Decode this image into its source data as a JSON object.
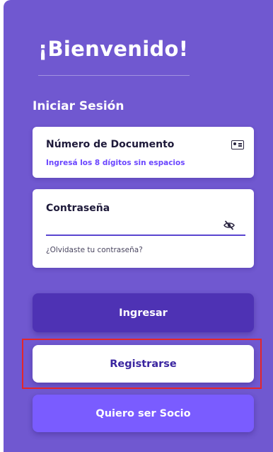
{
  "welcome": {
    "title": "¡Bienvenido!"
  },
  "login": {
    "section_title": "Iniciar Sesión",
    "document": {
      "label": "Número de Documento",
      "hint": "Ingresá los 8 dígitos sin espacios",
      "icon": "id-card-icon"
    },
    "password": {
      "label": "Contraseña",
      "value": "",
      "toggle_icon": "eye-slash-icon",
      "forgot_link": "¿Olvidaste tu contraseña?"
    }
  },
  "buttons": {
    "login_label": "Ingresar",
    "register_label": "Registrarse",
    "socio_label": "Quiero ser Socio"
  },
  "colors": {
    "panel_bg": "#7058d0",
    "login_button": "#4e32b4",
    "socio_button": "#7a5cff",
    "hint_text": "#6a45ff",
    "highlight_border": "#e3262b"
  }
}
